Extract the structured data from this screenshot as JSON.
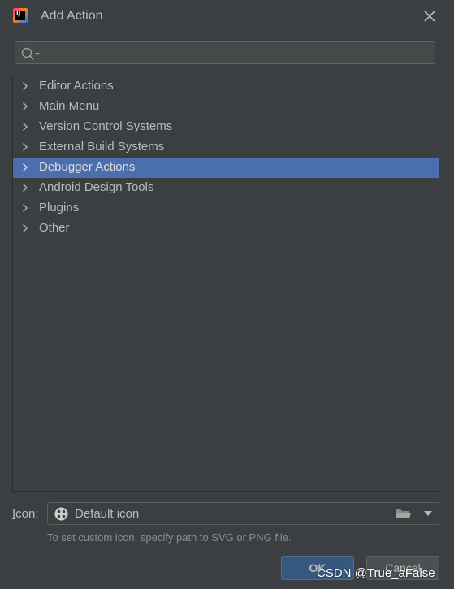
{
  "window": {
    "title": "Add Action",
    "app_icon_text": "IJ"
  },
  "search": {
    "value": "",
    "placeholder": ""
  },
  "tree": {
    "items": [
      {
        "label": "Editor Actions",
        "selected": false
      },
      {
        "label": "Main Menu",
        "selected": false
      },
      {
        "label": "Version Control Systems",
        "selected": false
      },
      {
        "label": "External Build Systems",
        "selected": false
      },
      {
        "label": "Debugger Actions",
        "selected": true
      },
      {
        "label": "Android Design Tools",
        "selected": false
      },
      {
        "label": "Plugins",
        "selected": false
      },
      {
        "label": "Other",
        "selected": false
      }
    ]
  },
  "icon_field": {
    "label_mnemonic": "I",
    "label_rest": "con:",
    "value": "Default icon",
    "hint": "To set custom icon, specify path to SVG or PNG file."
  },
  "buttons": {
    "ok": "OK",
    "cancel": "Cancel"
  },
  "watermark": "CSDN @True_aFalse",
  "colors": {
    "background": "#3c3f41",
    "selection": "#4b6eaf",
    "ok_button": "#365880",
    "text": "#bbbbbb"
  }
}
